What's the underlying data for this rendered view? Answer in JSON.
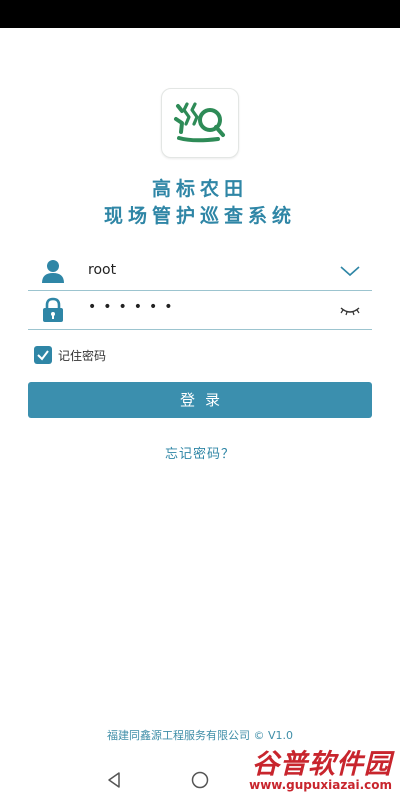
{
  "app": {
    "title_line1": "高标农田",
    "title_line2": "现场管护巡查系统",
    "logo_icon": "xun-logo-icon",
    "accent_color": "#2f86a6",
    "logo_color": "#2e8b57"
  },
  "login": {
    "username_icon": "user-icon",
    "username_value": "root",
    "username_action_icon": "chevron-down-icon",
    "password_icon": "lock-icon",
    "password_value": "••••••",
    "password_action_icon": "eye-closed-icon",
    "remember_checked": true,
    "remember_label": "记住密码",
    "submit_label": "登录",
    "forgot_label": "忘记密码？"
  },
  "footer": {
    "company": "福建同鑫源工程服务有限公司 © V1.0"
  },
  "watermark": {
    "main": "谷普软件园",
    "sub": "www.gupuxiazai.com"
  },
  "nav": {
    "back_icon": "back-triangle-icon",
    "home_icon": "home-circle-icon"
  }
}
